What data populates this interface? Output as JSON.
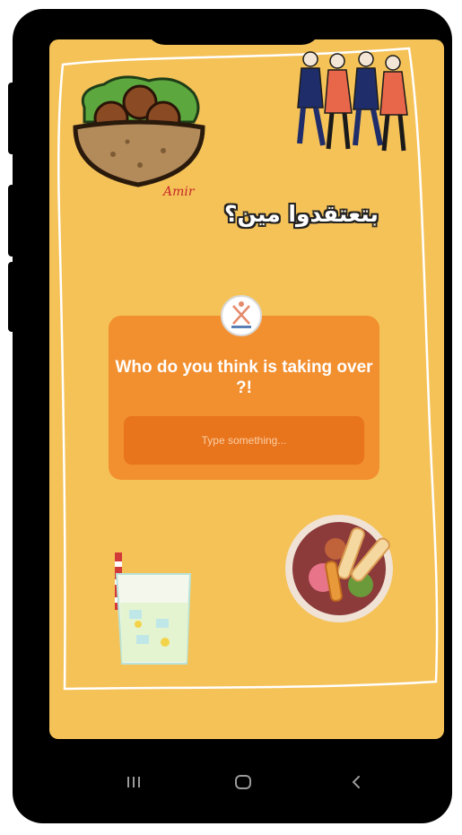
{
  "story": {
    "heading_ar": "بتعتقدوا مين؟",
    "signature": "Amir"
  },
  "question_card": {
    "question": "Who do you think is taking over ?!",
    "input_placeholder": "Type something..."
  },
  "nav_bar": {
    "items": [
      "recent-apps",
      "home",
      "back"
    ]
  },
  "colors": {
    "background": "#f5c258",
    "card": "#f28f2f",
    "input": "#e8741c"
  }
}
